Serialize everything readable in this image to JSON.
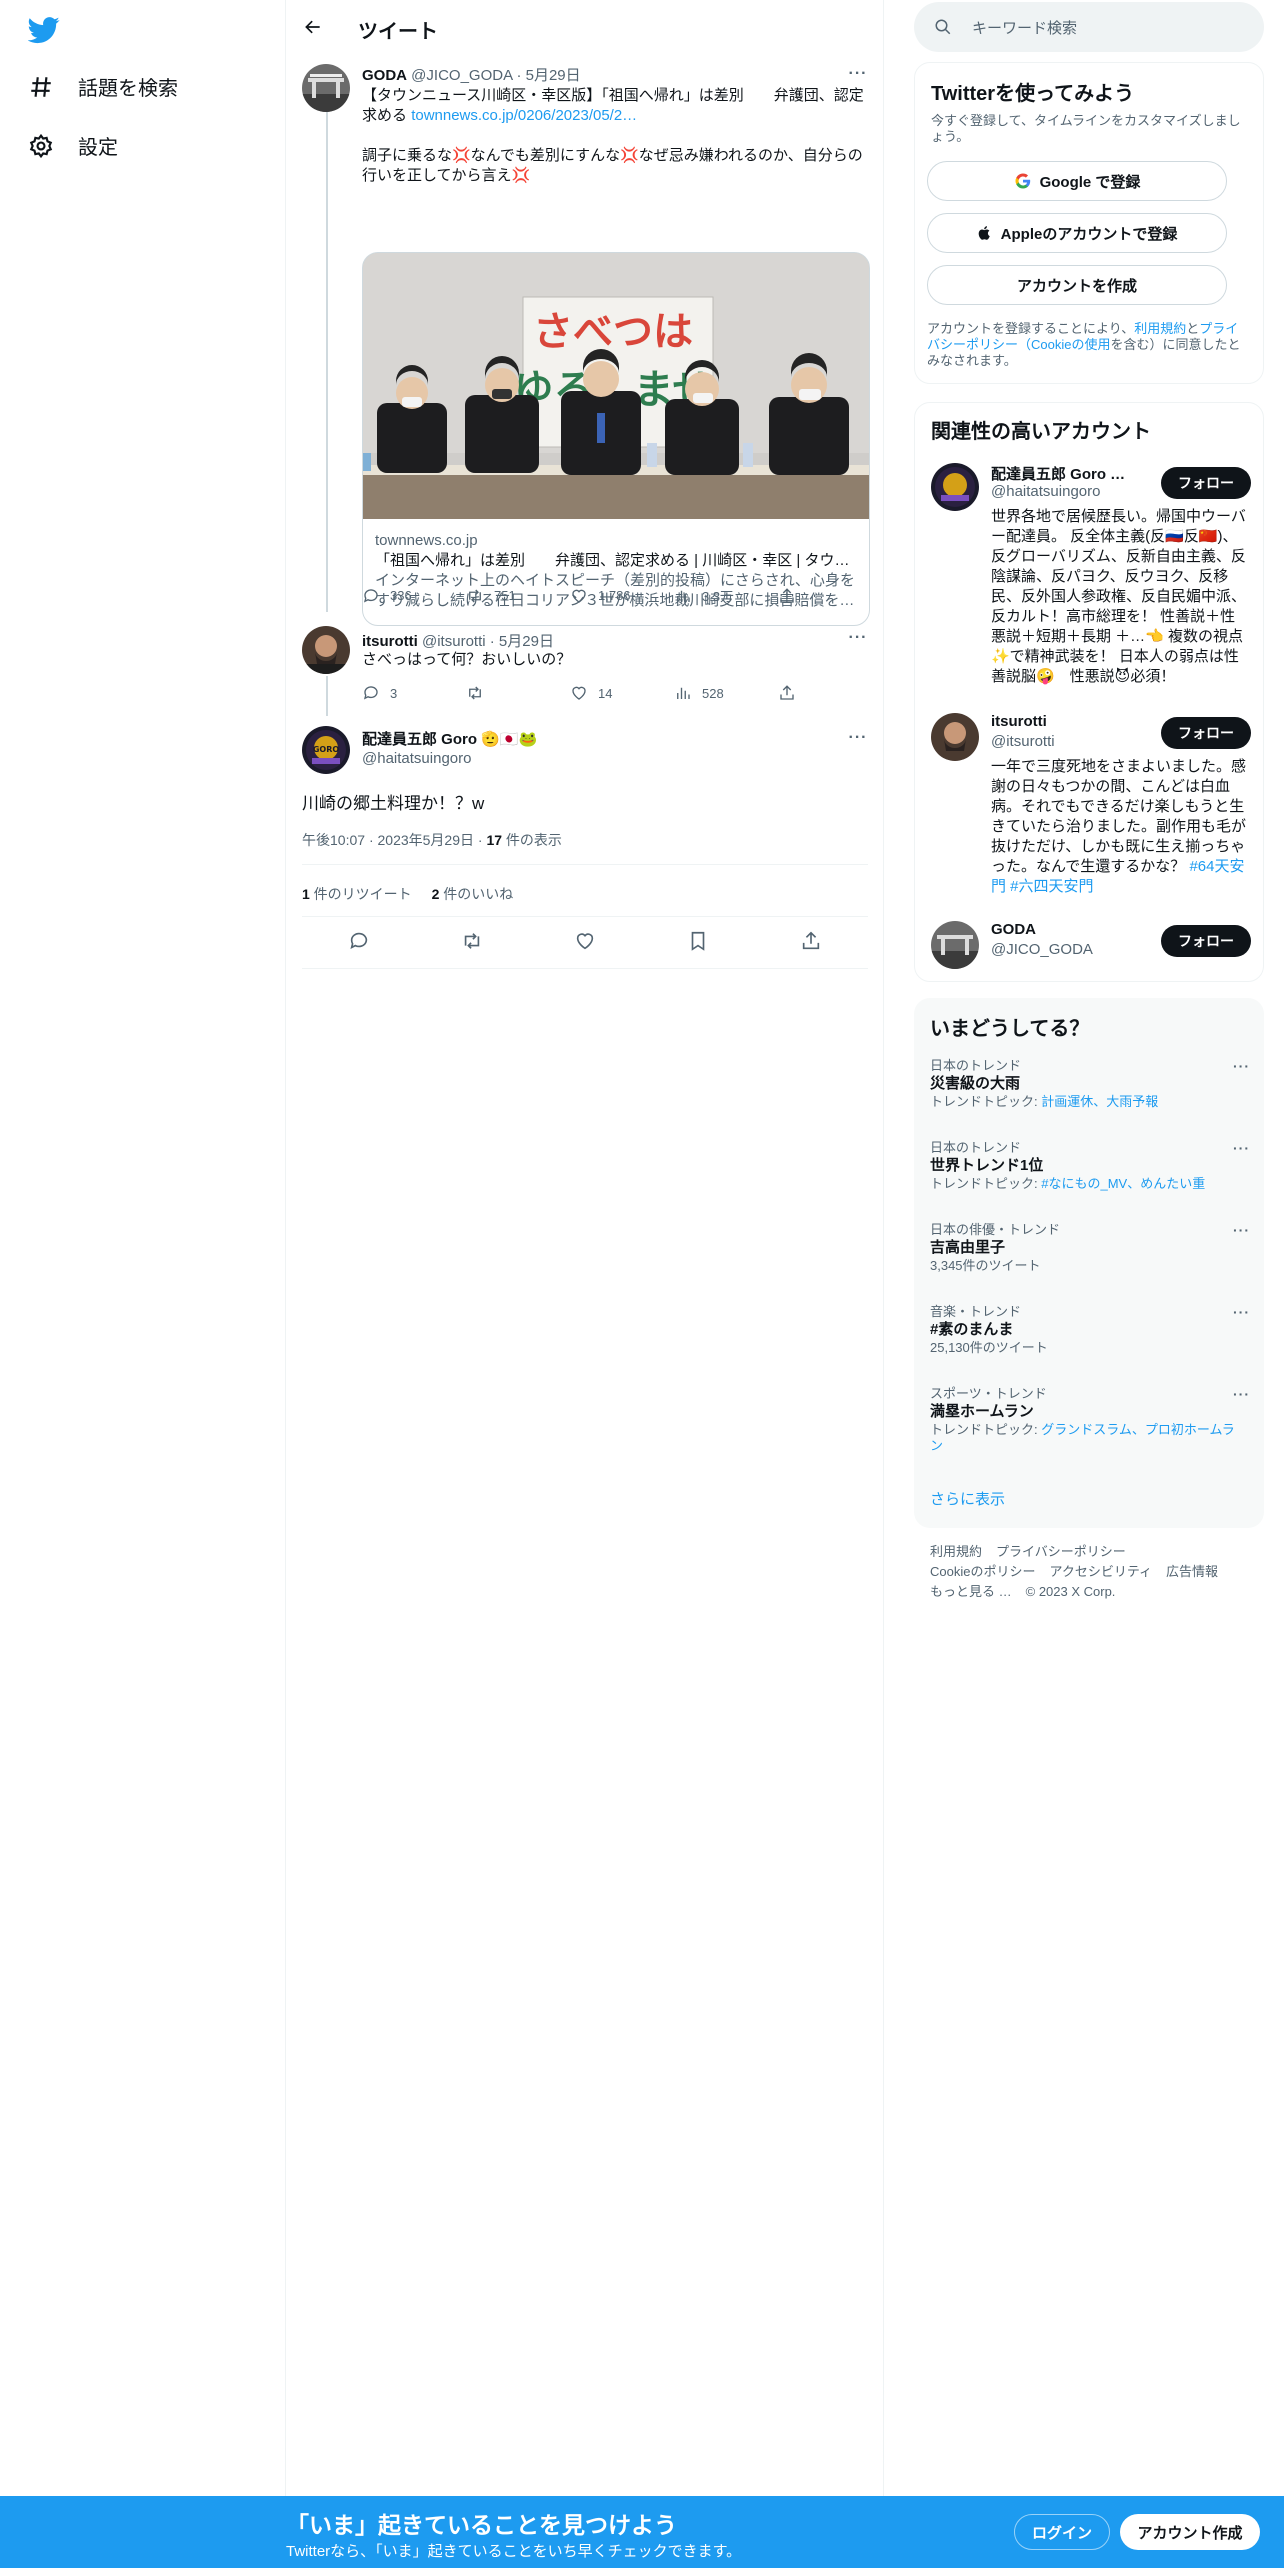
{
  "nav": {
    "explore_label": "話題を検索",
    "settings_label": "設定"
  },
  "header": {
    "title": "ツイート"
  },
  "tweet1": {
    "name": "GODA",
    "handle": "@JICO_GODA",
    "date": "5月29日",
    "text1": "【タウンニュース川崎区・幸区版】「祖国へ帰れ」は差別　　弁護団、認定求める",
    "link": "townnews.co.jp/0206/2023/05/2…",
    "text2": "調子に乗るな💢なんでも差別にすんな💢なぜ忌み嫌われるのか、自分らの行いを正してから言え💢",
    "card": {
      "banner_text": "さべつは ゆるしませ",
      "domain": "townnews.co.jp",
      "title": "「祖国へ帰れ」は差別　　弁護団、認定求める | 川崎区・幸区 | タウ…",
      "desc": "インターネット上のヘイトスピーチ（差別的投稿）にさらされ、心身をすり減らし続ける在日コリアン３世が横浜地裁川崎支部に損害賠償を…"
    },
    "replies": "336",
    "retweets": "751",
    "likes": "1,786",
    "views": "3.3万"
  },
  "tweet2": {
    "name": "itsurotti",
    "handle": "@itsurotti",
    "date": "5月29日",
    "text": "さべっはって何？おいしいの？",
    "replies": "3",
    "retweets": "",
    "likes": "14",
    "views": "528"
  },
  "main_tweet": {
    "name": "配達員五郎 Goro 🫡🇯🇵🐸",
    "handle": "@haitatsuingoro",
    "text": "川崎の郷土料理か！？w",
    "time": "午後10:07",
    "date": "2023年5月29日",
    "views_count": "17",
    "views_label": " 件の表示",
    "retweet_count": "1",
    "retweet_label": " 件のリツイート",
    "like_count": "2",
    "like_label": " 件のいいね"
  },
  "search": {
    "placeholder": "キーワード検索"
  },
  "signup": {
    "title": "Twitterを使ってみよう",
    "subtitle": "今すぐ登録して、タイムラインをカスタマイズしましょう。",
    "google_label": "Google で登録",
    "apple_label": "Appleのアカウントで登録",
    "create_label": "アカウントを作成",
    "legal_prefix": "アカウントを登録することにより、",
    "legal_terms": "利用規約",
    "legal_and": "と",
    "legal_privacy": "プライバシーポリシー（Cookieの使用",
    "legal_suffix": "を含む）に同意したとみなされます。"
  },
  "related": {
    "title": "関連性の高いアカウント",
    "follow_label": "フォロー",
    "accounts": [
      {
        "name": "配達員五郎 Goro 🫡🇯🇵🐸",
        "handle": "@haitatsuingoro",
        "bio": "世界各地で居候歴長い。帰国中ウーバー配達員。 反全体主義(反🇷🇺反🇨🇳)、反グローバリズム、反新自由主義、反陰謀論、反パヨク、反ウヨク、反移民、反外国人参政権、反自民媚中派、反カルト！高市総理を！ 性善説＋性悪説＋短期＋長期 ＋…👈 複数の視点✨で精神武装を！ 日本人の弱点は性善説脳🤪　性悪説😈必須！"
      },
      {
        "name": "itsurotti",
        "handle": "@itsurotti",
        "bio": "一年で三度死地をさまよいました。感謝の日々もつかの間、こんどは白血病。それでもできるだけ楽しもうと生きていたら治りました。副作用も毛が抜けただけ、しかも既に生え揃っちゃった。なんで生還するかな？",
        "tags": "#64天安門 #六四天安門"
      },
      {
        "name": "GODA",
        "handle": "@JICO_GODA",
        "bio": ""
      }
    ]
  },
  "trends": {
    "title": "いまどうしてる？",
    "items": [
      {
        "category": "日本のトレンド",
        "name": "災害級の大雨",
        "sub_prefix": "トレンドトピック: ",
        "sub_link": "計画運休、大雨予報"
      },
      {
        "category": "日本のトレンド",
        "name": "世界トレンド1位",
        "sub_prefix": "トレンドトピック: ",
        "sub_link": "#なにもの_MV、めんたい重"
      },
      {
        "category": "日本の俳優・トレンド",
        "name": "吉高由里子",
        "sub_prefix": "3,345件のツイート",
        "sub_link": ""
      },
      {
        "category": "音楽・トレンド",
        "name": "#素のまんま",
        "sub_prefix": "25,130件のツイート",
        "sub_link": ""
      },
      {
        "category": "スポーツ・トレンド",
        "name": "満塁ホームラン",
        "sub_prefix": "トレンドトピック: ",
        "sub_link": "グランドスラム、プロ初ホームラン"
      }
    ],
    "show_more": "さらに表示"
  },
  "footer": {
    "terms": "利用規約",
    "privacy": "プライバシーポリシー",
    "cookie": "Cookieのポリシー",
    "accessibility": "アクセシビリティ",
    "ads": "広告情報",
    "more": "もっと見る …",
    "copyright": "© 2023 X Corp."
  },
  "bottom_bar": {
    "title": "「いま」起きていることを見つけよう",
    "subtitle": "Twitterなら、「いま」起きていることをいち早くチェックできます。",
    "login": "ログイン",
    "signup": "アカウント作成"
  },
  "colors": {
    "brand": "#1d9bf0",
    "text": "#0f1419",
    "muted": "#536471"
  }
}
